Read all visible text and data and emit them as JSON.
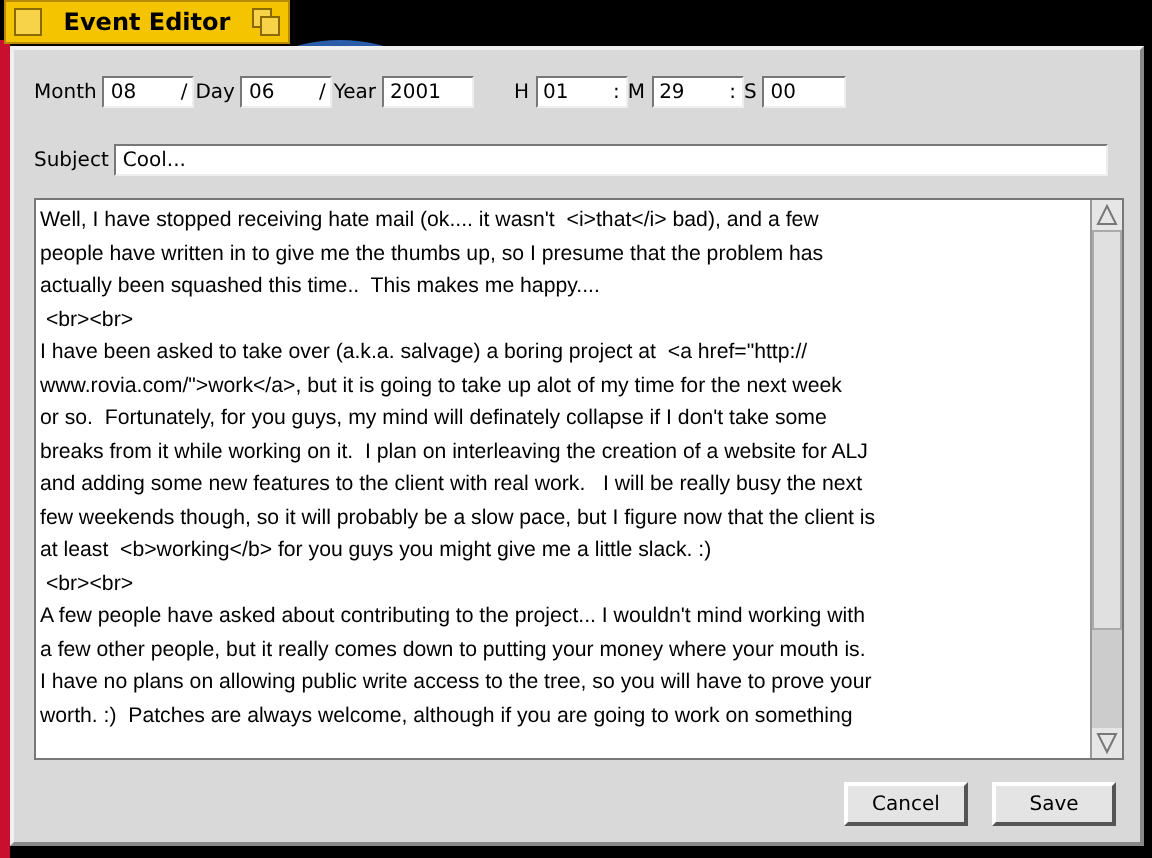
{
  "window": {
    "title": "Event Editor"
  },
  "date_fields": [
    {
      "label": "Month",
      "value": "08",
      "separator": "/"
    },
    {
      "label": "Day",
      "value": "06",
      "separator": "/"
    },
    {
      "label": "Year",
      "value": "2001"
    }
  ],
  "time_fields": [
    {
      "label": "H",
      "value": "01",
      "separator": ":"
    },
    {
      "label": "M",
      "value": "29",
      "separator": ":"
    },
    {
      "label": "S",
      "value": "00"
    }
  ],
  "subject": {
    "label": "Subject",
    "value": "Cool..."
  },
  "body_lines": [
    "Well, I have stopped receiving hate mail (ok.... it wasn't  <i>that</i> bad), and a few",
    "people have written in to give me the thumbs up, so I presume that the problem has",
    "actually been squashed this time..  This makes me happy....",
    " <br><br>",
    "I have been asked to take over (a.k.a. salvage) a boring project at  <a href=\"http://",
    "www.rovia.com/\">work</a>, but it is going to take up alot of my time for the next week",
    "or so.  Fortunately, for you guys, my mind will definately collapse if I don't take some",
    "breaks from it while working on it.  I plan on interleaving the creation of a website for ALJ",
    "and adding some new features to the client with real work.   I will be really busy the next",
    "few weekends though, so it will probably be a slow pace, but I figure now that the client is",
    "at least  <b>working</b> for you guys you might give me a little slack. :)",
    " <br><br>",
    "A few people have asked about contributing to the project... I wouldn't mind working with",
    "a few other people, but it really comes down to putting your money where your mouth is.",
    "I have no plans on allowing public write access to the tree, so you will have to prove your",
    "worth. :)  Patches are always welcome, although if you are going to work on something"
  ],
  "buttons": [
    "Cancel",
    "Save"
  ]
}
